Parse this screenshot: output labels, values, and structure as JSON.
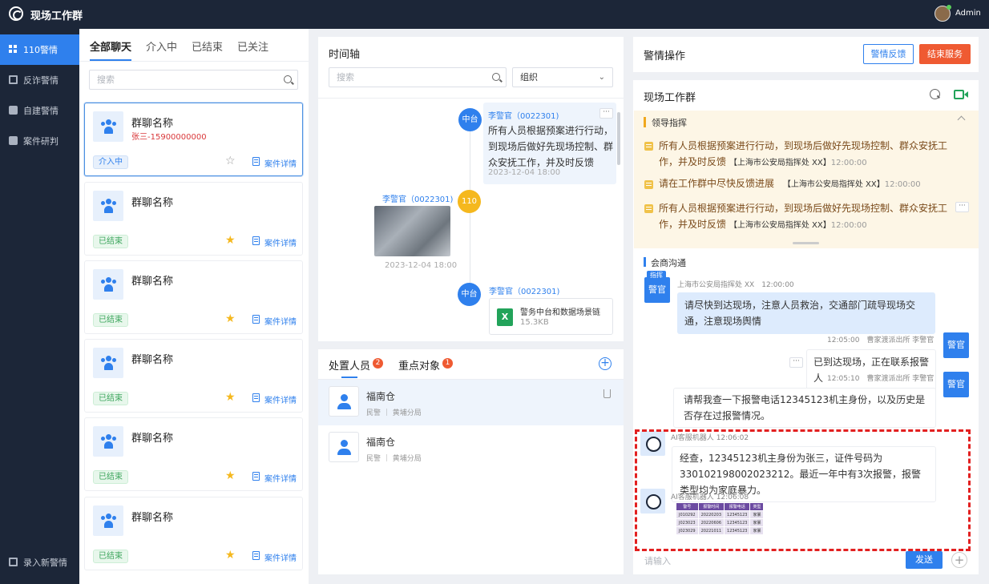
{
  "app": {
    "title": "现场工作群",
    "user": "Admin"
  },
  "nav": [
    {
      "label": "110警情",
      "icon": "grid-icon"
    },
    {
      "label": "反诈警情",
      "icon": "briefcase-icon"
    },
    {
      "label": "自建警情",
      "icon": "note-icon"
    },
    {
      "label": "案件研判",
      "icon": "chat-icon"
    },
    {
      "label": "录入新警情",
      "icon": "edit-icon"
    }
  ],
  "chatlist": {
    "tabs": [
      "全部聊天",
      "介入中",
      "已结束",
      "已关注"
    ],
    "search_placeholder": "搜索",
    "detail_label": "案件详情",
    "groups": [
      {
        "name": "群聊名称",
        "sub": "张三-15900000000",
        "status": "介入中",
        "starred": false
      },
      {
        "name": "群聊名称",
        "sub": "",
        "status": "已结束",
        "starred": true
      },
      {
        "name": "群聊名称",
        "sub": "",
        "status": "已结束",
        "starred": true
      },
      {
        "name": "群聊名称",
        "sub": "",
        "status": "已结束",
        "starred": true
      },
      {
        "name": "群聊名称",
        "sub": "",
        "status": "已结束",
        "starred": true
      },
      {
        "name": "群聊名称",
        "sub": "",
        "status": "已结束",
        "starred": true
      }
    ]
  },
  "timeline": {
    "title": "时间轴",
    "search_placeholder": "搜索",
    "org_select": "组织",
    "events": [
      {
        "badge": "中台",
        "author": "李警官（0022301)",
        "text": "所有人员根据预案进行行动，到现场后做好先现场控制、群众安抚工作，并及时反馈",
        "time": "2023-12-04 18:00"
      },
      {
        "badge": "110",
        "author": "李警官（0022301)",
        "time": "2023-12-04 18:00"
      },
      {
        "badge": "中台",
        "author": "李警官（0022301)",
        "file_name": "警务中台和数据场景链",
        "file_size": "15.3KB"
      }
    ]
  },
  "people": {
    "tab1": "处置人员",
    "tab1_count": "2",
    "tab2": "重点对象",
    "tab2_count": "1",
    "rows": [
      {
        "name": "福南仓",
        "role": "民警",
        "unit": "黄埔分局"
      },
      {
        "name": "福南仓",
        "role": "民警",
        "unit": "黄埔分局"
      }
    ]
  },
  "ops": {
    "title": "警情操作",
    "feedback": "警情反馈",
    "end": "结束服务"
  },
  "group": {
    "title": "现场工作群",
    "leader_title": "领导指挥",
    "commands": [
      {
        "text": "所有人员根据预案进行行动，到现场后做好先现场控制、群众安抚工作，并及时反馈",
        "org": "【上海市公安局指挥处 XX】",
        "time": "12:00:00"
      },
      {
        "text": "请在工作群中尽快反馈进展",
        "org": "【上海市公安局指挥处 XX】",
        "time": "12:00:00"
      },
      {
        "text": "所有人员根据预案进行行动，到现场后做好先现场控制、群众安抚工作，并及时反馈",
        "org": "【上海市公安局指挥处 XX】",
        "time": "12:00:00"
      }
    ],
    "consult_title": "会商沟通",
    "messages": [
      {
        "sender": "上海市公安局指挥处 XX",
        "time": "12:00:00",
        "avatar": "警官",
        "tag": "指挥",
        "text": "请尽快到达现场，注意人员救治，交通部门疏导现场交通，注意现场舆情"
      },
      {
        "sender": "曹家渡派出所 李警官",
        "time": "12:05:00",
        "avatar": "警官",
        "text": "已到达现场，正在联系报警人"
      },
      {
        "sender": "曹家渡派出所 李警官",
        "time": "12:05:10",
        "avatar": "警官",
        "text": "请帮我查一下报警电话12345123机主身份，以及历史是否存在过报警情况。"
      },
      {
        "sender": "AI客服机器人",
        "time": "12:06:02",
        "text": "经查，12345123机主身份为张三，证件号码为330102198002023212。最近一年中有3次报警，报警类型均为家庭暴力。"
      },
      {
        "sender": "AI客服机器人",
        "time": "12:06:08"
      }
    ],
    "table": {
      "headers": [
        "警号",
        "报警时间",
        "报警电话",
        "类型"
      ],
      "rows": [
        [
          "J010292",
          "20220203",
          "12345123",
          "家暴"
        ],
        [
          "J023023",
          "20220606",
          "12345123",
          "家暴"
        ],
        [
          "J023029",
          "20221011",
          "12345123",
          "家暴"
        ]
      ]
    },
    "input_placeholder": "请输入",
    "send": "发送"
  },
  "colors": {
    "accent": "#2f80ed",
    "danger": "#ef5a32",
    "nav_bg": "#1c2638",
    "leader_bg": "#fdf6e6"
  }
}
